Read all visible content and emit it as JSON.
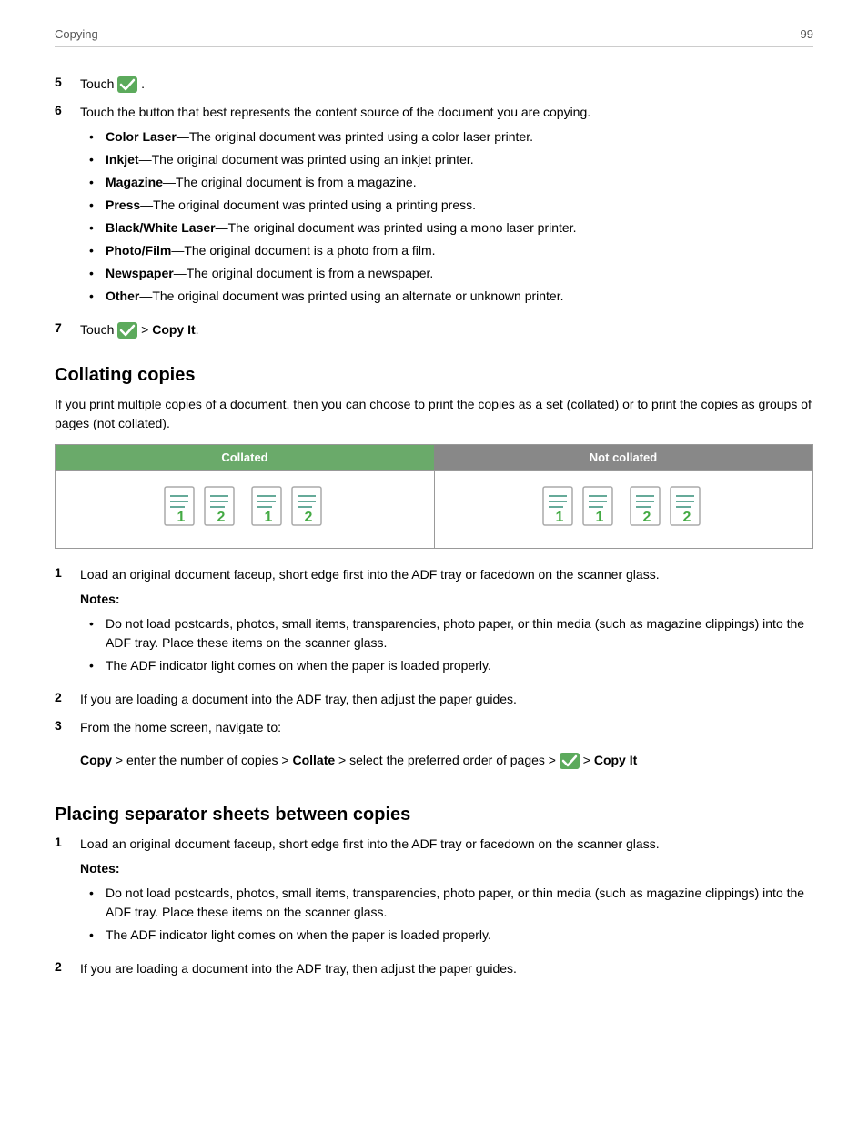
{
  "header": {
    "left": "Copying",
    "right": "99"
  },
  "step5": {
    "num": "5",
    "text": "Touch",
    "suffix": "."
  },
  "step6": {
    "num": "6",
    "text": "Touch the button that best represents the content source of the document you are copying.",
    "bullets": [
      {
        "bold": "Color Laser",
        "sep": "—",
        "rest": "The original document was printed using a color laser printer."
      },
      {
        "bold": "Inkjet",
        "sep": "—",
        "rest": "The original document was printed using an inkjet printer."
      },
      {
        "bold": "Magazine",
        "sep": "—",
        "rest": "The original document is from a magazine."
      },
      {
        "bold": "Press",
        "sep": "—",
        "rest": "The original document was printed using a printing press."
      },
      {
        "bold": "Black/White Laser",
        "sep": "—",
        "rest": "The original document was printed using a mono laser printer."
      },
      {
        "bold": "Photo/Film",
        "sep": "—",
        "rest": "The original document is a photo from a film."
      },
      {
        "bold": "Newspaper",
        "sep": "—",
        "rest": "The original document is from a newspaper."
      },
      {
        "bold": "Other",
        "sep": "—",
        "rest": "The original document was printed using an alternate or unknown printer."
      }
    ]
  },
  "step7": {
    "num": "7",
    "prefix": "Touch",
    "suffix": "> Copy It."
  },
  "collating": {
    "title": "Collating copies",
    "intro": "If you print multiple copies of a document, then you can choose to print the copies as a set (collated) or to print the copies as groups of pages (not collated).",
    "table_headers": {
      "collated": "Collated",
      "not_collated": "Not collated"
    }
  },
  "collating_steps": [
    {
      "num": "1",
      "text": "Load an original document faceup, short edge first into the ADF tray or facedown on the scanner glass.",
      "notes_label": "Notes:",
      "notes": [
        "Do not load postcards, photos, small items, transparencies, photo paper, or thin media (such as magazine clippings) into the ADF tray. Place these items on the scanner glass.",
        "The ADF indicator light comes on when the paper is loaded properly."
      ]
    },
    {
      "num": "2",
      "text": "If you are loading a document into the ADF tray, then adjust the paper guides."
    },
    {
      "num": "3",
      "text": "From the home screen, navigate to:",
      "nav": "Copy > enter the number of copies > Collate > select the preferred order of pages >",
      "nav_bold_parts": [
        "Collate",
        "Copy It"
      ],
      "nav_suffix": "> Copy It"
    }
  ],
  "separator": {
    "title": "Placing separator sheets between copies",
    "steps": [
      {
        "num": "1",
        "text": "Load an original document faceup, short edge first into the ADF tray or facedown on the scanner glass.",
        "notes_label": "Notes:",
        "notes": [
          "Do not load postcards, photos, small items, transparencies, photo paper, or thin media (such as magazine clippings) into the ADF tray. Place these items on the scanner glass.",
          "The ADF indicator light comes on when the paper is loaded properly."
        ]
      },
      {
        "num": "2",
        "text": "If you are loading a document into the ADF tray, then adjust the paper guides."
      }
    ]
  }
}
